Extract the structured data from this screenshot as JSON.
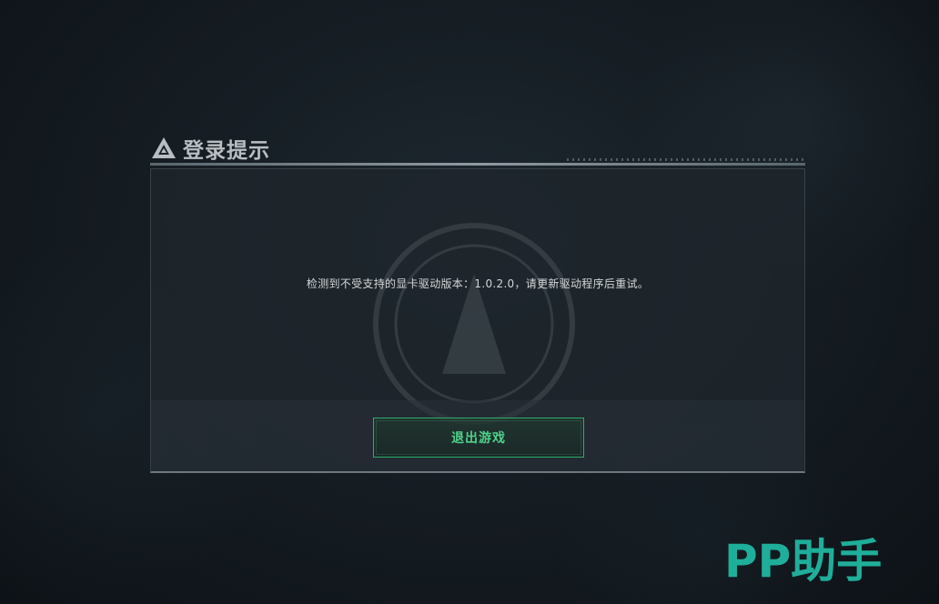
{
  "dialog": {
    "title": "登录提示",
    "message": "检测到不受支持的显卡驱动版本：1.0.2.0，请更新驱动程序后重试。",
    "exit_button_label": "退出游戏",
    "title_icon": "triangle-logo-icon"
  },
  "watermark": {
    "text": "PP助手"
  },
  "colors": {
    "accent": "#4fd18a",
    "button_border": "#2fae6a",
    "watermark": "#1fae9a"
  }
}
